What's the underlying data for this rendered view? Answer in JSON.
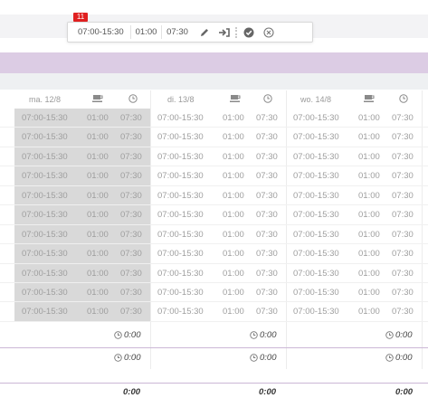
{
  "badge": "11",
  "toolbar": {
    "time_value": "07:00-15:30",
    "break_value": "01:00",
    "total_value": "07:30"
  },
  "days": [
    {
      "label": "ma. 12/8"
    },
    {
      "label": "di. 13/8"
    },
    {
      "label": "wo. 14/8"
    }
  ],
  "shift": {
    "time": "07:00-15:30",
    "break": "01:00",
    "total": "07:30"
  },
  "row_count": 11,
  "summary": {
    "row1": "0:00",
    "row2": "0:00",
    "total": "0:00"
  },
  "colors": {
    "selected_column": "#d9d9d9",
    "accent_purple": "#dccce4",
    "badge_red": "#e02020"
  }
}
